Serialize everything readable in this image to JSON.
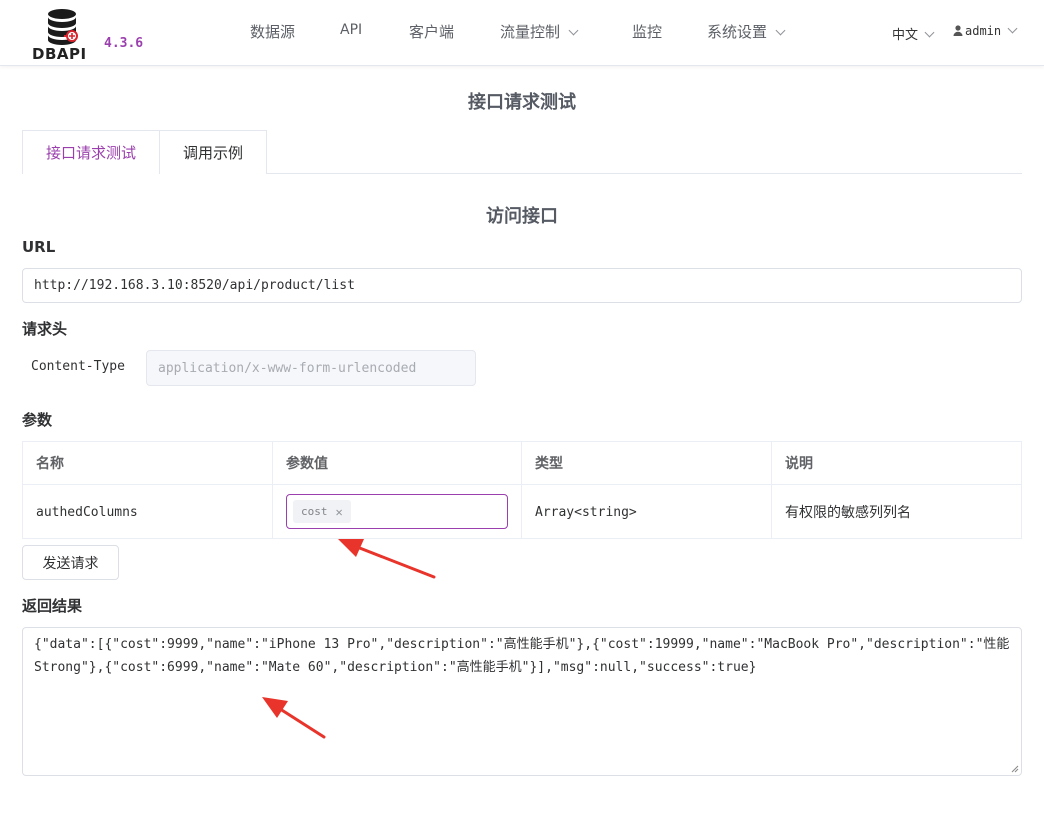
{
  "app": {
    "name": "DBAPI",
    "version": "4.3.6"
  },
  "nav": {
    "items": [
      {
        "label": "数据源"
      },
      {
        "label": "API"
      },
      {
        "label": "客户端"
      },
      {
        "label": "流量控制"
      },
      {
        "label": "监控"
      },
      {
        "label": "系统设置"
      }
    ],
    "language": "中文",
    "user": "admin"
  },
  "page": {
    "title": "接口请求测试",
    "tabs": [
      {
        "label": "接口请求测试",
        "active": true
      },
      {
        "label": "调用示例",
        "active": false
      }
    ],
    "section_title": "访问接口"
  },
  "url": {
    "label": "URL",
    "value": "http://192.168.3.10:8520/api/product/list"
  },
  "headers": {
    "label": "请求头",
    "key": "Content-Type",
    "placeholder": "application/x-www-form-urlencoded"
  },
  "params": {
    "label": "参数",
    "columns": [
      "名称",
      "参数值",
      "类型",
      "说明"
    ],
    "rows": [
      {
        "name": "authedColumns",
        "tag": "cost",
        "type": "Array<string>",
        "desc": "有权限的敏感列列名"
      }
    ]
  },
  "send_button": "发送请求",
  "result": {
    "label": "返回结果",
    "value": "{\"data\":[{\"cost\":9999,\"name\":\"iPhone 13 Pro\",\"description\":\"高性能手机\"},{\"cost\":19999,\"name\":\"MacBook Pro\",\"description\":\"性能 Strong\"},{\"cost\":6999,\"name\":\"Mate 60\",\"description\":\"高性能手机\"}],\"msg\":null,\"success\":true}"
  },
  "colors": {
    "accent": "#9b3fae",
    "arrow": "#e8342a"
  }
}
